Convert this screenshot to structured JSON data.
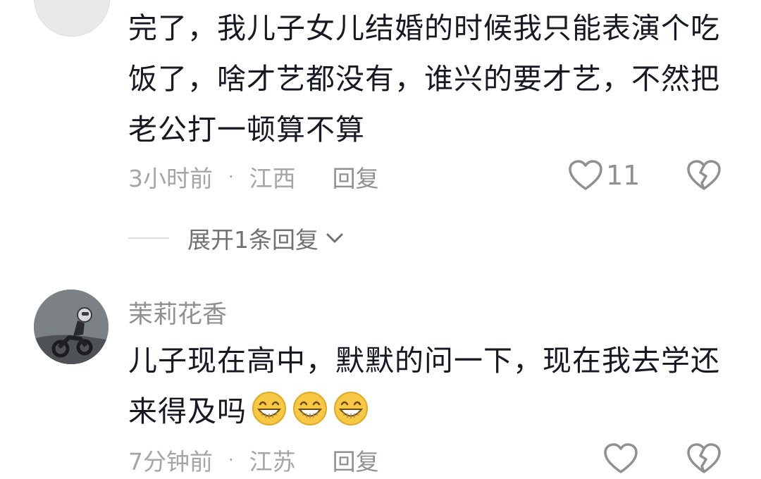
{
  "comments": [
    {
      "text": "完了，我儿子女儿结婚的时候我只能表演个吃饭了，啥才艺都没有，谁兴的要才艺，不然把老公打一顿算不算",
      "time": "3小时前",
      "separator": "·",
      "location": "江西",
      "reply_label": "回复",
      "like_count": "11",
      "expand_replies": "展开1条回复"
    },
    {
      "username": "茉莉花香",
      "text": "儿子现在高中，默默的问一下，现在我去学还来得及吗",
      "emojis": [
        "grin-emoji",
        "grin-emoji",
        "grin-emoji"
      ],
      "time": "7分钟前",
      "separator": "·",
      "location": "江苏",
      "reply_label": "回复"
    }
  ],
  "colors": {
    "text": "#161823",
    "meta": "#a3a5a8",
    "emoji_fill": "#f7c843"
  }
}
